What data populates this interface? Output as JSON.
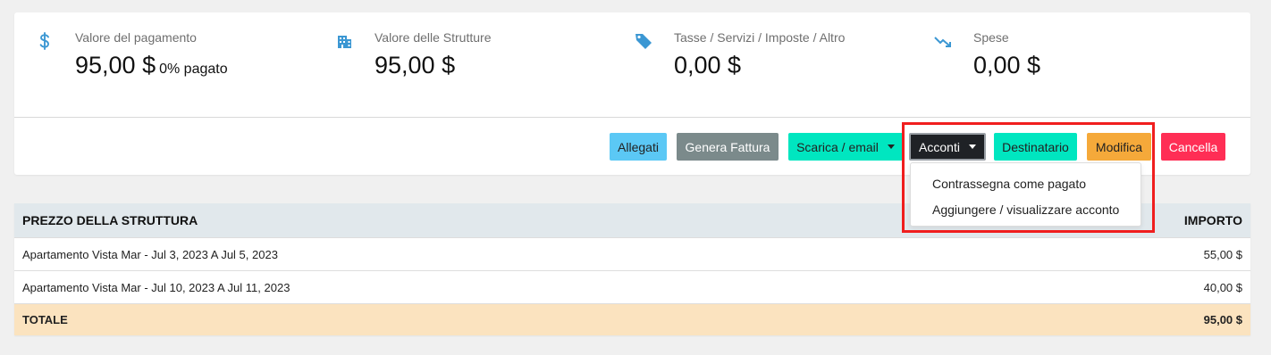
{
  "summary": {
    "payment": {
      "label": "Valore del pagamento",
      "value": "95,00 $",
      "sub": "0% pagato",
      "icon": "dollar-icon"
    },
    "structures": {
      "label": "Valore delle Strutture",
      "value": "95,00 $",
      "icon": "building-icon"
    },
    "taxes": {
      "label": "Tasse / Servizi / Imposte / Altro",
      "value": "0,00 $",
      "icon": "tag-icon"
    },
    "expenses": {
      "label": "Spese",
      "value": "0,00 $",
      "icon": "trend-down-icon"
    }
  },
  "actions": {
    "attachments": "Allegati",
    "invoice": "Genera Fattura",
    "download": "Scarica / email",
    "deposits": "Acconti",
    "recipient": "Destinatario",
    "edit": "Modifica",
    "delete": "Cancella"
  },
  "deposits_menu": {
    "items": [
      "Contrassegna come pagato",
      "Aggiungere / visualizzare acconto"
    ]
  },
  "table": {
    "headers": {
      "description": "PREZZO DELLA STRUTTURA",
      "amount": "IMPORTO"
    },
    "rows": [
      {
        "description": "Apartamento Vista Mar - Jul 3, 2023 A Jul 5, 2023",
        "amount": "55,00 $"
      },
      {
        "description": "Apartamento Vista Mar - Jul 10, 2023 A Jul 11, 2023",
        "amount": "40,00 $"
      }
    ],
    "total": {
      "label": "TOTALE",
      "amount": "95,00 $"
    }
  },
  "colors": {
    "accent_blue": "#3b97d3",
    "btn_attachments": "#5bc8f5",
    "btn_invoice": "#7b8a8b",
    "btn_teal": "#00e6c0",
    "btn_dark": "#1f2226",
    "btn_edit": "#f5a93a",
    "btn_delete": "#ff2e55",
    "highlight": "#f01e1e"
  }
}
